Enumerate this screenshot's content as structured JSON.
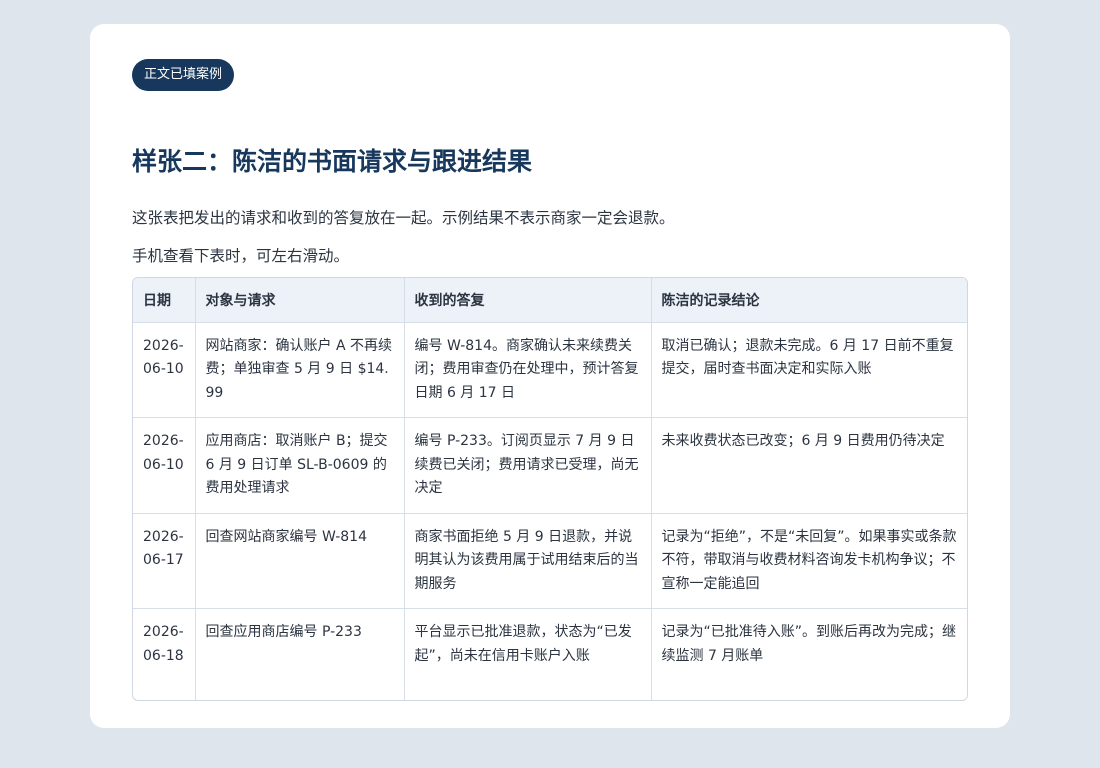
{
  "badge": "正文已填案例",
  "title": "样张二：陈洁的书面请求与跟进结果",
  "intro": "这张表把发出的请求和收到的答复放在一起。示例结果不表示商家一定会退款。",
  "hint": "手机查看下表时，可左右滑动。",
  "table": {
    "headers": [
      "日期",
      "对象与请求",
      "收到的答复",
      "陈洁的记录结论"
    ],
    "rows": [
      {
        "date": "2026-06-10",
        "request": "网站商家：确认账户 A 不再续费；单独审查 5 月 9 日 $14.99",
        "reply": "编号 W-814。商家确认未来续费关闭；费用审查仍在处理中，预计答复日期 6 月 17 日",
        "conclusion": "取消已确认；退款未完成。6 月 17 日前不重复提交，届时查书面决定和实际入账"
      },
      {
        "date": "2026-06-10",
        "request": "应用商店：取消账户 B；提交 6 月 9 日订单 SL-B-0609 的费用处理请求",
        "reply": "编号 P-233。订阅页显示 7 月 9 日续费已关闭；费用请求已受理，尚无决定",
        "conclusion": "未来收费状态已改变；6 月 9 日费用仍待决定"
      },
      {
        "date": "2026-06-17",
        "request": "回查网站商家编号 W-814",
        "reply": "商家书面拒绝 5 月 9 日退款，并说明其认为该费用属于试用结束后的当期服务",
        "conclusion": "记录为“拒绝”，不是“未回复”。如果事实或条款不符，带取消与收费材料咨询发卡机构争议；不宣称一定能追回"
      },
      {
        "date": "2026-06-18",
        "request": "回查应用商店编号 P-233",
        "reply": "平台显示已批准退款，状态为“已发起”，尚未在信用卡账户入账",
        "conclusion": "记录为“已批准待入账”。到账后再改为完成；继续监测 7 月账单"
      }
    ]
  }
}
